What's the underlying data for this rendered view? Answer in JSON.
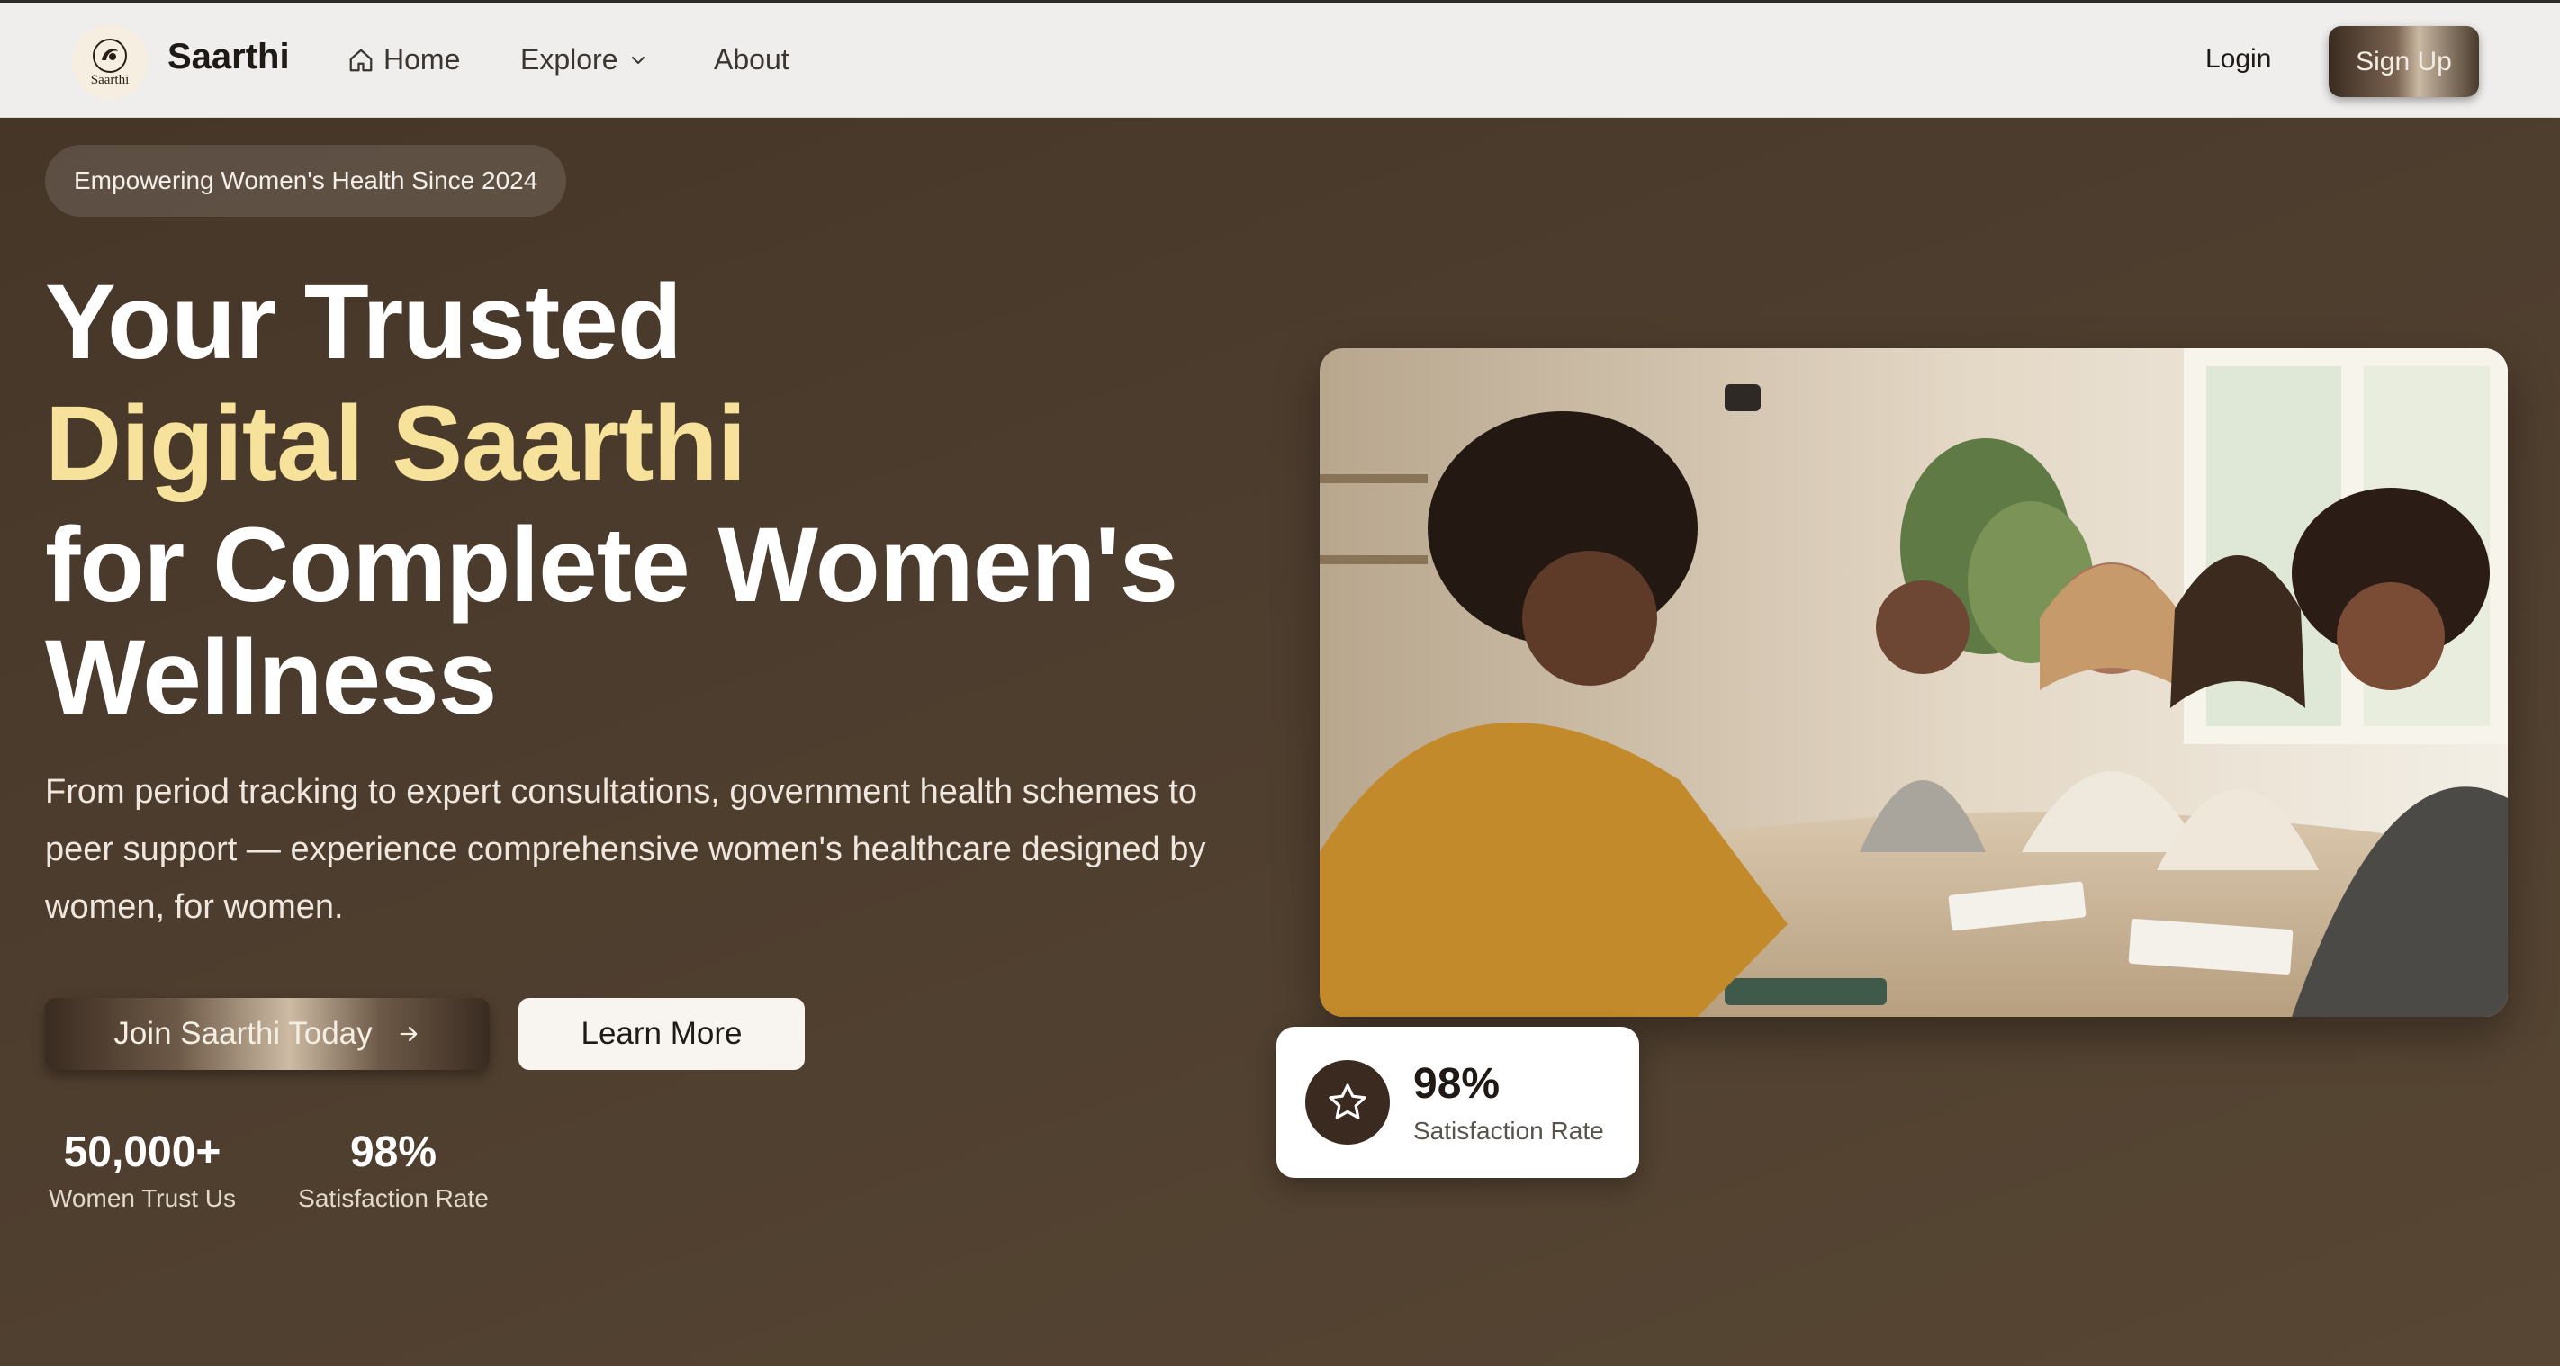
{
  "nav": {
    "logo_text": "Saarthi",
    "brand": "Saarthi",
    "links": [
      {
        "label": "Home",
        "icon": "home-icon"
      },
      {
        "label": "Explore",
        "icon": "chevron-down-icon"
      },
      {
        "label": "About"
      }
    ],
    "login": "Login",
    "signup": "Sign Up"
  },
  "hero": {
    "badge": "Empowering Women's Health Since 2024",
    "heading": {
      "line1": "Your Trusted",
      "line2": "Digital Saarthi",
      "line3": "for Complete Women's",
      "line4": "Wellness"
    },
    "subtitle": "From period tracking to expert consultations, government health schemes to peer support — experience comprehensive women's healthcare designed by women, for women.",
    "buttons": {
      "join": "Join Saarthi Today",
      "learn": "Learn More"
    },
    "stats": [
      {
        "value": "50,000+",
        "label": "Women Trust Us"
      },
      {
        "value": "98%",
        "label": "Satisfaction Rate"
      }
    ],
    "rate_card": {
      "value": "98%",
      "label": "Satisfaction Rate",
      "icon": "star-icon"
    }
  },
  "colors": {
    "hero_bg": "#4d3d2e",
    "accent_yellow": "#f6e29a",
    "nav_bg": "#efeeec"
  }
}
